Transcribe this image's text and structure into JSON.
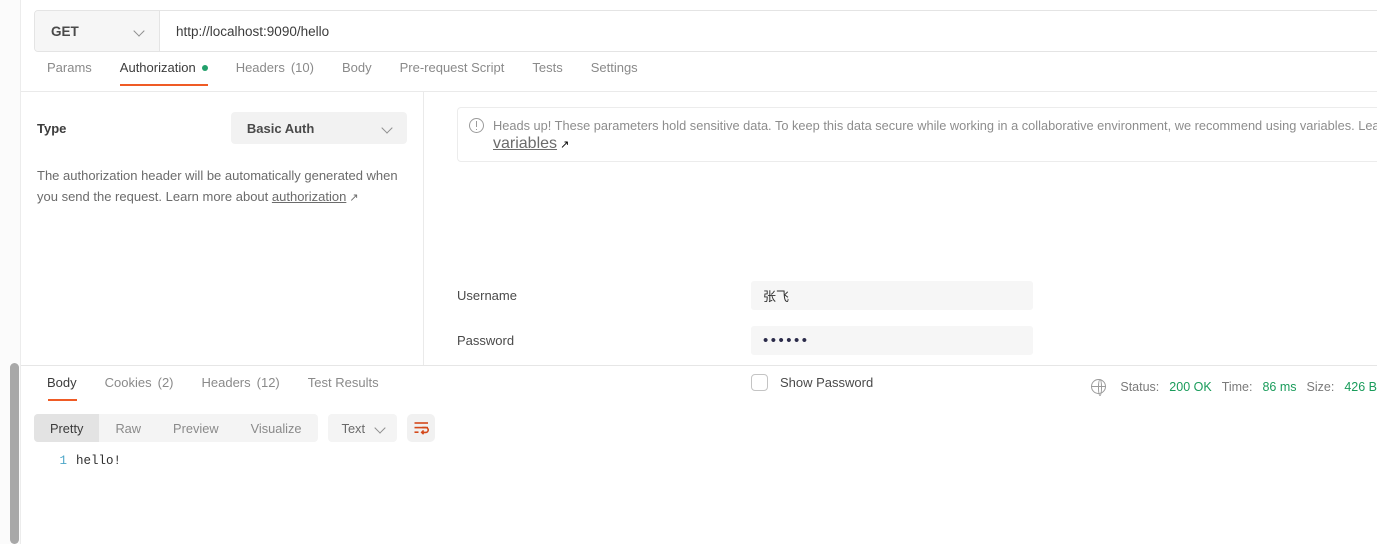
{
  "request": {
    "method": "GET",
    "url": "http://localhost:9090/hello",
    "tabs": [
      {
        "label": "Params",
        "count": "",
        "dot": false,
        "active": false
      },
      {
        "label": "Authorization",
        "count": "",
        "dot": true,
        "active": true
      },
      {
        "label": "Headers",
        "count": "(10)",
        "dot": false,
        "active": false
      },
      {
        "label": "Body",
        "count": "",
        "dot": false,
        "active": false
      },
      {
        "label": "Pre-request Script",
        "count": "",
        "dot": false,
        "active": false
      },
      {
        "label": "Tests",
        "count": "",
        "dot": false,
        "active": false
      },
      {
        "label": "Settings",
        "count": "",
        "dot": false,
        "active": false
      }
    ]
  },
  "authorization": {
    "type_label": "Type",
    "type_value": "Basic Auth",
    "description_line1": "The authorization header will be automatically generated when",
    "description_line2_prefix": "you send the request. Learn more about ",
    "description_link": "authorization",
    "warning": {
      "line1": "Heads up! These parameters hold sensitive data. To keep this data secure while working in a collaborative environment, we recommend using variables. Learn mo",
      "line2_link": "variables"
    },
    "username_label": "Username",
    "username_value": "张飞",
    "password_label": "Password",
    "password_value": "••••••",
    "show_password_label": "Show Password"
  },
  "response": {
    "tabs": [
      {
        "label": "Body",
        "count": "",
        "active": true
      },
      {
        "label": "Cookies",
        "count": "(2)",
        "active": false
      },
      {
        "label": "Headers",
        "count": "(12)",
        "active": false
      },
      {
        "label": "Test Results",
        "count": "",
        "active": false
      }
    ],
    "meta": {
      "status_label": "Status:",
      "status_value": "200 OK",
      "time_label": "Time:",
      "time_value": "86 ms",
      "size_label": "Size:",
      "size_value": "426 B"
    },
    "view_modes": [
      {
        "label": "Pretty",
        "active": true
      },
      {
        "label": "Raw",
        "active": false
      },
      {
        "label": "Preview",
        "active": false
      },
      {
        "label": "Visualize",
        "active": false
      }
    ],
    "format_value": "Text",
    "code_lines": [
      {
        "number": "1",
        "text": "hello!"
      }
    ]
  },
  "colors": {
    "accent": "#ef5b25",
    "success": "#22a06b",
    "status_green": "#1a9c5b",
    "link_blue": "#4da6c8"
  }
}
